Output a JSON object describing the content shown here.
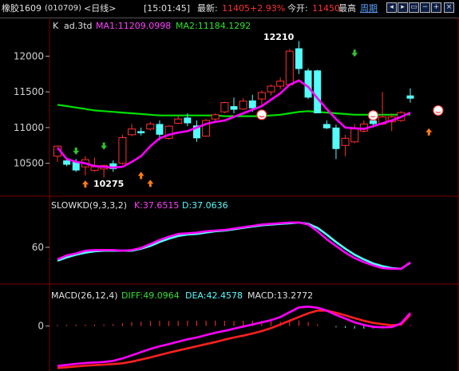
{
  "header": {
    "instrument": "橡胶1609",
    "code": "(010709)",
    "period": "<日线>",
    "time": "[15:01:45]",
    "last_label": "最新:",
    "last_value": "11405",
    "change_pct": "+2.93%",
    "open_label": "今开:",
    "open_value": "11450",
    "high_label": "最高",
    "week_link": "周期",
    "toolbar_icons": [
      "left-arrow-icon",
      "right-arrow-icon",
      "window-icon",
      "zoom-out-icon",
      "zoom-in-icon",
      "close-icon"
    ]
  },
  "colors": {
    "up": "#ff3030",
    "down": "#54fcfc",
    "ma1": "#ff00ff",
    "ma2": "#00e000",
    "kd_k": "#ff00ff",
    "kd_d": "#54fcfc",
    "diff": "#ff00ff",
    "dea": "#ff2020",
    "grid": "#7a0000",
    "axis": "#aaaaaa"
  },
  "panels": {
    "price": {
      "label_k": "K",
      "label_name": "ad.3td",
      "ma1_label": "MA1:11209.0998",
      "ma2_label": "MA2:11184.1292",
      "high_annotation": "12210",
      "low_annotation": "10275"
    },
    "kd": {
      "label": "SLOWKD(9,3,3,2)",
      "k_label": "K:37.6515",
      "d_label": "D:37.0636"
    },
    "macd": {
      "label": "MACD(26,12,4)",
      "diff_label": "DIFF:49.0964",
      "dea_label": "DEA:42.4578",
      "macd_label": "MACD:13.2772"
    }
  },
  "chart_data": [
    {
      "type": "candlestick",
      "yticks": [
        10500,
        11000,
        11500,
        12000
      ],
      "ylim": [
        10150,
        12250
      ],
      "candles": [
        {
          "o": 10600,
          "h": 10750,
          "l": 10520,
          "c": 10740
        },
        {
          "o": 10540,
          "h": 10560,
          "l": 10460,
          "c": 10480
        },
        {
          "o": 10520,
          "h": 10560,
          "l": 10380,
          "c": 10400
        },
        {
          "o": 10450,
          "h": 10600,
          "l": 10330,
          "c": 10550
        },
        {
          "o": 10400,
          "h": 10580,
          "l": 10380,
          "c": 10450
        },
        {
          "o": 10420,
          "h": 10480,
          "l": 10300,
          "c": 10470
        },
        {
          "o": 10500,
          "h": 10540,
          "l": 10380,
          "c": 10420
        },
        {
          "o": 10500,
          "h": 10900,
          "l": 10480,
          "c": 10860
        },
        {
          "o": 10900,
          "h": 11050,
          "l": 10880,
          "c": 10980
        },
        {
          "o": 10950,
          "h": 11000,
          "l": 10890,
          "c": 10920
        },
        {
          "o": 10980,
          "h": 11080,
          "l": 10960,
          "c": 11050
        },
        {
          "o": 11050,
          "h": 11100,
          "l": 10820,
          "c": 10900
        },
        {
          "o": 10850,
          "h": 11030,
          "l": 10830,
          "c": 11020
        },
        {
          "o": 11060,
          "h": 11160,
          "l": 11050,
          "c": 11120
        },
        {
          "o": 11140,
          "h": 11200,
          "l": 11020,
          "c": 11060
        },
        {
          "o": 11030,
          "h": 11100,
          "l": 10800,
          "c": 10850
        },
        {
          "o": 10880,
          "h": 11120,
          "l": 10870,
          "c": 11100
        },
        {
          "o": 11120,
          "h": 11200,
          "l": 11080,
          "c": 11180
        },
        {
          "o": 11220,
          "h": 11360,
          "l": 11200,
          "c": 11350
        },
        {
          "o": 11300,
          "h": 11420,
          "l": 11200,
          "c": 11250
        },
        {
          "o": 11260,
          "h": 11410,
          "l": 11250,
          "c": 11370
        },
        {
          "o": 11380,
          "h": 11460,
          "l": 11220,
          "c": 11270
        },
        {
          "o": 11400,
          "h": 11520,
          "l": 11290,
          "c": 11490
        },
        {
          "o": 11500,
          "h": 11600,
          "l": 11450,
          "c": 11580
        },
        {
          "o": 11580,
          "h": 11700,
          "l": 11540,
          "c": 11650
        },
        {
          "o": 11600,
          "h": 12100,
          "l": 11580,
          "c": 12070
        },
        {
          "o": 12110,
          "h": 12210,
          "l": 11750,
          "c": 11820
        },
        {
          "o": 11800,
          "h": 11830,
          "l": 11400,
          "c": 11420
        },
        {
          "o": 11800,
          "h": 11810,
          "l": 11200,
          "c": 11200
        },
        {
          "o": 11050,
          "h": 11100,
          "l": 10980,
          "c": 10990
        },
        {
          "o": 11000,
          "h": 11040,
          "l": 10560,
          "c": 10700
        },
        {
          "o": 10750,
          "h": 10900,
          "l": 10600,
          "c": 10850
        },
        {
          "o": 10800,
          "h": 11050,
          "l": 10780,
          "c": 10980
        },
        {
          "o": 10950,
          "h": 11100,
          "l": 10930,
          "c": 11050
        },
        {
          "o": 11100,
          "h": 11170,
          "l": 11000,
          "c": 11050
        },
        {
          "o": 11050,
          "h": 11500,
          "l": 11030,
          "c": 11150
        },
        {
          "o": 11080,
          "h": 11200,
          "l": 10950,
          "c": 11150
        },
        {
          "o": 11100,
          "h": 11230,
          "l": 11080,
          "c": 11210
        },
        {
          "o": 11450,
          "h": 11550,
          "l": 11350,
          "c": 11405
        }
      ],
      "ma1": [
        10720,
        10560,
        10520,
        10500,
        10460,
        10450,
        10440,
        10450,
        10520,
        10600,
        10740,
        10850,
        10900,
        10930,
        10950,
        11000,
        11050,
        11080,
        11100,
        11150,
        11200,
        11250,
        11300,
        11390,
        11480,
        11600,
        11660,
        11570,
        11410,
        11260,
        11120,
        11000,
        10990,
        10980,
        11020,
        11060,
        11100,
        11150,
        11209
      ],
      "ma2": [
        11320,
        11300,
        11280,
        11260,
        11240,
        11230,
        11220,
        11210,
        11200,
        11190,
        11180,
        11170,
        11170,
        11170,
        11170,
        11170,
        11170,
        11170,
        11160,
        11160,
        11160,
        11160,
        11160,
        11170,
        11180,
        11200,
        11220,
        11230,
        11220,
        11210,
        11200,
        11190,
        11180,
        11180,
        11180,
        11180,
        11180,
        11180,
        11184
      ]
    },
    {
      "type": "line",
      "name": "SLOWKD",
      "yticks": [
        60
      ],
      "ylim": [
        10,
        110
      ],
      "series": [
        {
          "name": "K",
          "values": [
            42,
            48,
            51,
            55,
            56,
            56,
            56,
            55,
            56,
            59,
            65,
            71,
            76,
            80,
            81,
            82,
            84,
            85,
            86,
            88,
            90,
            92,
            94,
            95,
            96,
            97,
            97,
            94,
            84,
            72,
            62,
            52,
            44,
            38,
            33,
            29,
            28,
            28,
            37.6515
          ]
        },
        {
          "name": "D",
          "values": [
            40,
            45,
            49,
            52,
            54,
            55,
            55,
            55,
            55,
            58,
            62,
            68,
            73,
            77,
            79,
            80,
            82,
            84,
            85,
            87,
            89,
            91,
            93,
            94,
            95,
            96,
            97,
            95,
            89,
            79,
            68,
            58,
            49,
            42,
            36,
            32,
            29,
            28,
            37.0636
          ]
        }
      ]
    },
    {
      "type": "line",
      "name": "MACD",
      "yticks": [
        0
      ],
      "ylim": [
        -160,
        110
      ],
      "series": [
        {
          "name": "DIFF",
          "values": [
            -150,
            -146,
            -142,
            -139,
            -137,
            -135,
            -131,
            -122,
            -110,
            -98,
            -86,
            -76,
            -68,
            -59,
            -50,
            -43,
            -34,
            -25,
            -18,
            -10,
            -2,
            6,
            14,
            22,
            34,
            52,
            70,
            73,
            69,
            58,
            42,
            28,
            14,
            4,
            -3,
            -5,
            -4,
            10,
            49.0964
          ]
        },
        {
          "name": "DEA",
          "values": [
            -158,
            -155,
            -152,
            -149,
            -147,
            -145,
            -143,
            -140,
            -134,
            -126,
            -118,
            -109,
            -100,
            -92,
            -84,
            -76,
            -68,
            -60,
            -51,
            -43,
            -36,
            -28,
            -19,
            -8,
            6,
            20,
            34,
            48,
            58,
            58,
            50,
            40,
            30,
            20,
            12,
            7,
            3,
            6,
            42.4578
          ]
        }
      ]
    }
  ]
}
